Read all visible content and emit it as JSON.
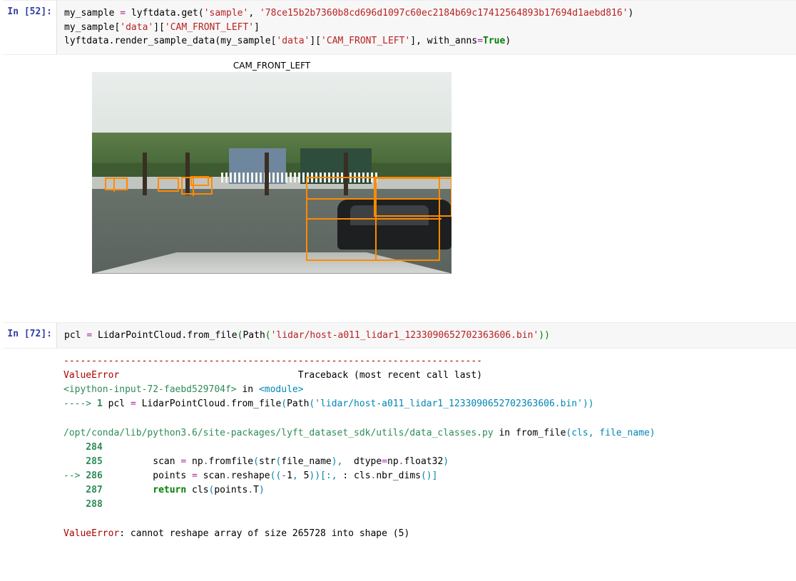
{
  "cell1": {
    "prompt": "In [52]:",
    "code": {
      "l1": {
        "a": "my_sample ",
        "b": "=",
        "c": " lyftdata.get(",
        "d": "'sample'",
        "e": ", ",
        "f": "'78ce15b2b7360b8cd696d1097c60ec2184b69c17412564893b17694d1aebd816'",
        "g": ")"
      },
      "l2": {
        "a": "my_sample[",
        "b": "'data'",
        "c": "][",
        "d": "'CAM_FRONT_LEFT'",
        "e": "]"
      },
      "l3": {
        "a": "lyftdata.render_sample_data(my_sample[",
        "b": "'data'",
        "c": "][",
        "d": "'CAM_FRONT_LEFT'",
        "e": "], with_anns",
        "f": "=",
        "g": "True",
        "h": ")"
      }
    },
    "image_title": "CAM_FRONT_LEFT"
  },
  "cell2": {
    "prompt": "In [72]:",
    "code": {
      "l1": {
        "a": "pcl ",
        "b": "=",
        "c": " LidarPointCloud.from_file",
        "d": "(",
        "e": "Path",
        "f": "(",
        "g": "'lidar/host-a011_lidar1_1233090652702363606.bin'",
        "h": ")",
        "i": ")"
      }
    }
  },
  "tb": {
    "sep": "---------------------------------------------------------------------------",
    "err_name": "ValueError",
    "head_tail": "                                Traceback (most recent call last)",
    "frame1_loc": "<ipython-input-72-faebd529704f>",
    "frame1_in": " in ",
    "frame1_mod": "<module>",
    "arrow1": "----> ",
    "n1": "1",
    "f1": {
      "a": " pcl ",
      "b": "=",
      "c": " LidarPointCloud",
      "d": ".",
      "e": "from_file",
      "f": "(",
      "g": "Path",
      "h": "(",
      "i": "'lidar/host-a011_lidar1_1233090652702363606.bin'",
      "j": ")",
      "k": ")"
    },
    "frame2_loc": "/opt/conda/lib/python3.6/site-packages/lyft_dataset_sdk/utils/data_classes.py",
    "frame2_in": " in from_file",
    "frame2_sig": "(cls, file_name)",
    "n284": "    284",
    "n285": "    285",
    "l285": {
      "a": "         scan ",
      "b": "=",
      "c": " np",
      "d": ".",
      "e": "fromfile",
      "f": "(",
      "g": "str",
      "h": "(",
      "i": "file_name",
      "j": "),",
      "k": "  dtype",
      "l": "=",
      "m": "np",
      "n": ".",
      "o": "float32",
      "p": ")"
    },
    "arrow2": "--> ",
    "n286": "286",
    "l286": {
      "a": "         points ",
      "b": "=",
      "c": " scan",
      "d": ".",
      "e": "reshape",
      "f": "((",
      "g": "-",
      "h": "1",
      "i": ", ",
      "j": "5",
      "k": "))[:,",
      "l": " : ",
      "m": "cls",
      "n": ".",
      "o": "nbr_dims",
      "p": "()]"
    },
    "n287": "    287",
    "l287": {
      "a": "         ",
      "b": "return",
      "c": " cls",
      "d": "(",
      "e": "points",
      "f": ".",
      "g": "T",
      "h": ")"
    },
    "n288": "    288",
    "final_err": "ValueError",
    "final_msg": ": cannot reshape array of size 265728 into shape (5)"
  }
}
